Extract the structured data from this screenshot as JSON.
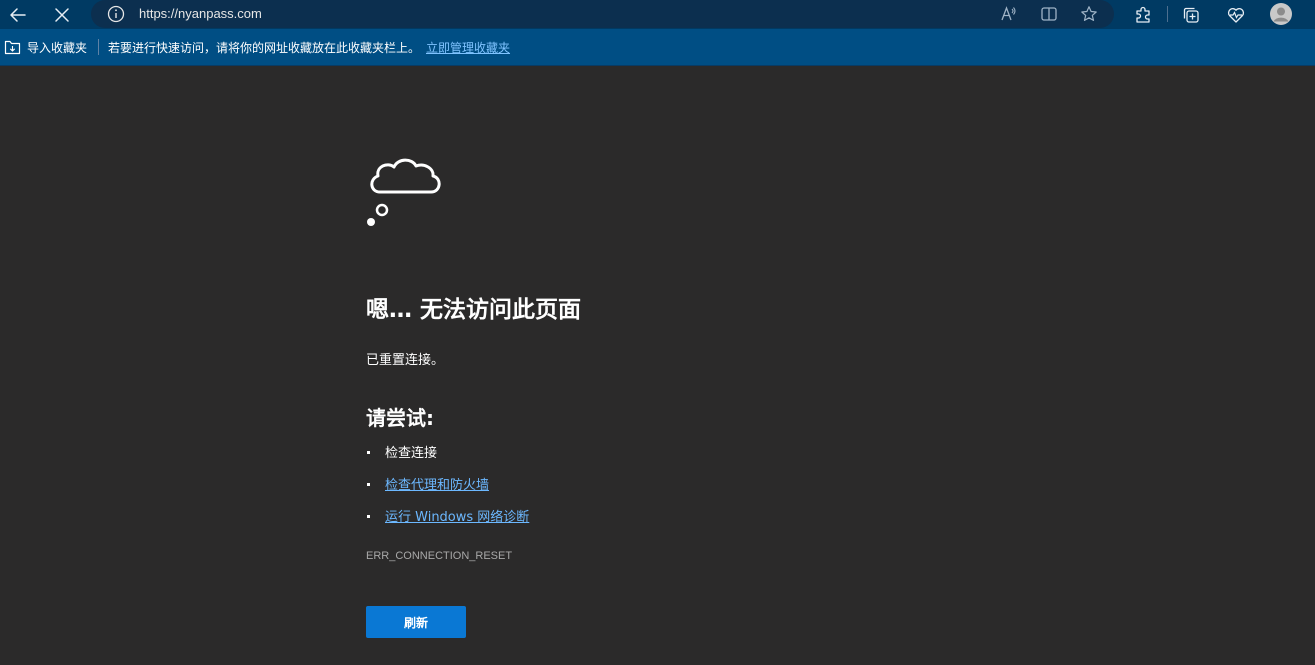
{
  "browser": {
    "url": "https://nyanpass.com",
    "icons": {
      "back": "back-arrow-icon",
      "stop": "close-icon",
      "info": "info-icon",
      "read_aloud": "read-aloud-icon",
      "split_screen": "split-screen-icon",
      "favorite": "star-icon",
      "extensions": "puzzle-icon",
      "collections": "collections-icon",
      "performance": "heart-pulse-icon",
      "profile": "avatar-icon"
    },
    "colors": {
      "toolbar": "#003a63",
      "favbar": "#004e84",
      "link": "#6cb8ff",
      "accent": "#0a78d4"
    }
  },
  "favbar": {
    "import_label": "导入收藏夹",
    "hint": "若要进行快速访问，请将你的网址收藏放在此收藏夹栏上。",
    "manage_link": "立即管理收藏夹"
  },
  "error_page": {
    "title": "嗯… 无法访问此页面",
    "subtitle": "已重置连接。",
    "try_title": "请尝试:",
    "tips": [
      {
        "label": "检查连接",
        "is_link": false
      },
      {
        "label": "检查代理和防火墙",
        "is_link": true
      },
      {
        "label": "运行 Windows 网络诊断",
        "is_link": true
      }
    ],
    "error_code": "ERR_CONNECTION_RESET",
    "refresh_label": "刷新"
  }
}
